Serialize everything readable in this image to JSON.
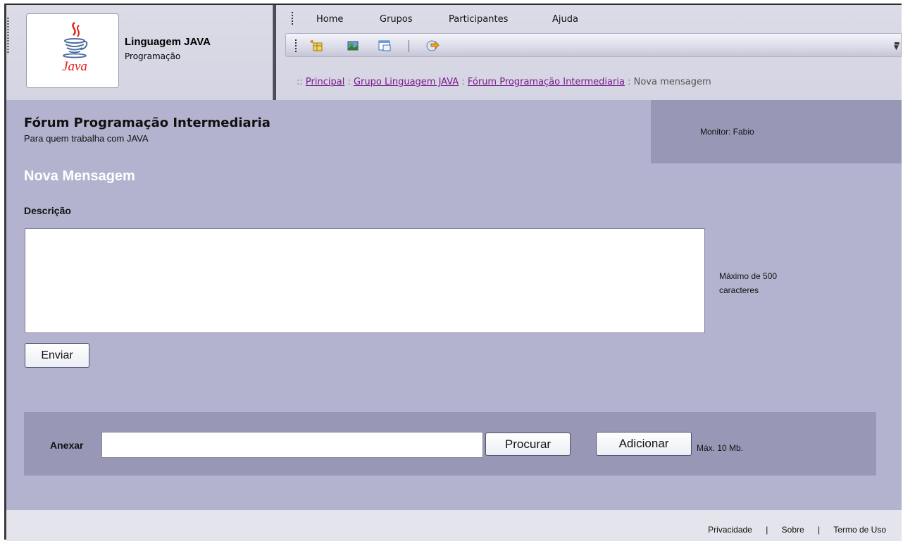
{
  "logo": {
    "small_text": "Java"
  },
  "group": {
    "title": "Linguagem JAVA",
    "subtitle": "Programação"
  },
  "menu": {
    "items": [
      "Home",
      "Grupos",
      "Participantes",
      "Ajuda"
    ]
  },
  "toolbar": {
    "icons": [
      "new-item-icon",
      "image-icon",
      "window-icon",
      "logout-icon"
    ]
  },
  "breadcrumb": {
    "prefix": "::",
    "links": [
      "Principal",
      "Grupo Linguagem JAVA",
      "Fórum Programação Intermediaria"
    ],
    "separator": ":",
    "current": "Nova mensagem"
  },
  "forum": {
    "title": "Fórum Programação Intermediaria",
    "subtitle": "Para quem trabalha com JAVA",
    "monitor": "Monitor: Fabio"
  },
  "form": {
    "heading": "Nova Mensagem",
    "description_label": "Descrição",
    "description_value": "",
    "max_chars_note": "Máximo de 500 caracteres",
    "send_label": "Enviar"
  },
  "attach": {
    "label": "Anexar",
    "file_value": "",
    "browse_label": "Procurar",
    "add_label": "Adicionar",
    "max_size_note": "Máx. 10 Mb."
  },
  "footer": {
    "links": [
      "Privacidade",
      "Sobre",
      "Termo de Uso"
    ],
    "separator": "|"
  },
  "colors": {
    "main_background": "#b3b3cf",
    "panel_background": "#9898b6",
    "link": "#7a1a8c",
    "heading_white": "#ffffff"
  }
}
